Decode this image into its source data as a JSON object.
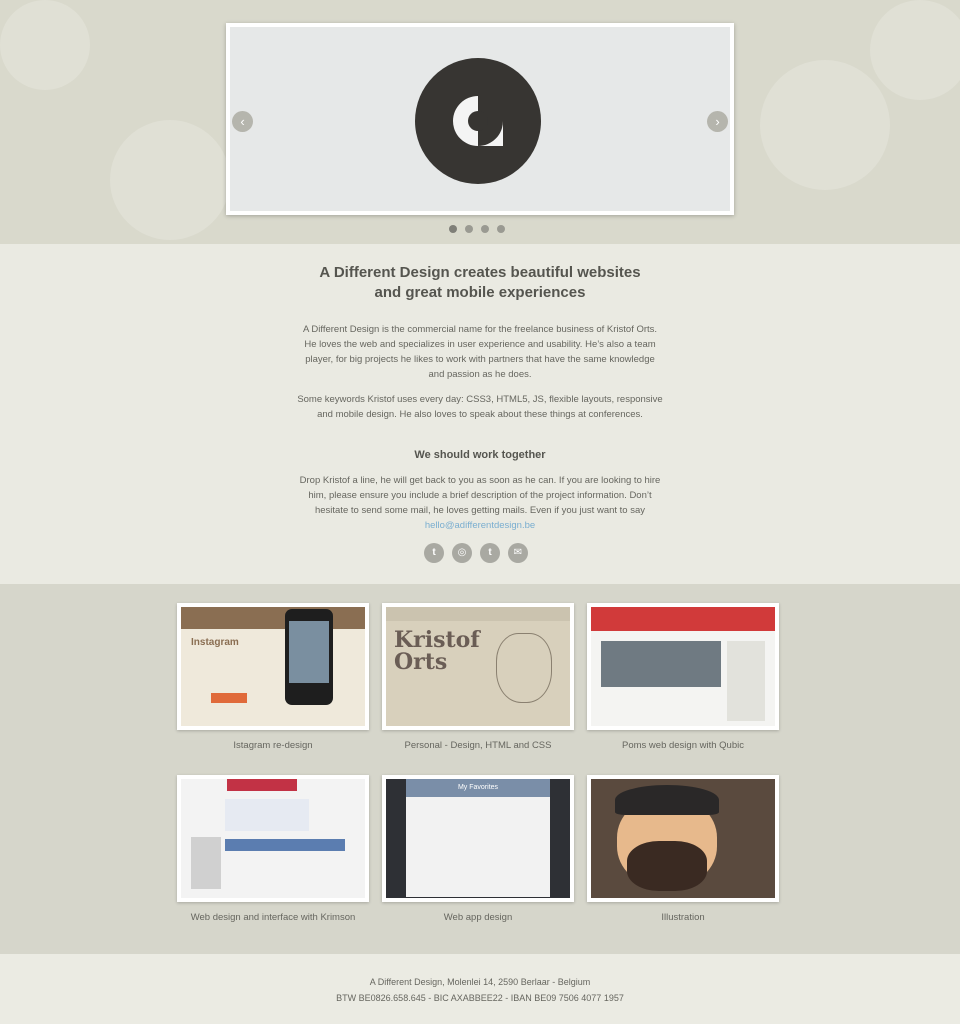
{
  "slider": {
    "prev_icon": "chevron-left-icon",
    "next_icon": "chevron-right-icon",
    "prev_glyph": "‹",
    "next_glyph": "›",
    "logo": "a-different-design-logo",
    "slide_count": 4,
    "active_slide": 1
  },
  "intro": {
    "headline_line1": "A Different Design creates beautiful websites",
    "headline_line2": "and great mobile experiences",
    "paragraph1": "A Different Design is the commercial name for the freelance business of Kristof Orts. He loves the web and specializes in user experience and usability. He’s also a team player, for big projects he likes to work with partners that have the same knowledge and passion as he does.",
    "paragraph2": "Some keywords Kristof uses every day: CSS3, HTML5, JS, flexible layouts, responsive and mobile design. He also loves to speak about these things at conferences."
  },
  "contact": {
    "heading": "We should work together",
    "paragraph": "Drop Kristof a line, he will get back to you as soon as he can. If you are looking to hire him, please ensure you include a brief description of the project information. Don’t hesitate to send some mail, he loves getting mails. Even if you just want to say",
    "email": "hello@adifferentdesign.be",
    "socials": [
      {
        "icon": "twitter-icon",
        "glyph": "t"
      },
      {
        "icon": "dribbble-icon",
        "glyph": "◎"
      },
      {
        "icon": "tumblr-icon",
        "glyph": "t"
      },
      {
        "icon": "mail-icon",
        "glyph": "✉"
      }
    ]
  },
  "portfolio": {
    "items": [
      {
        "caption": "Istagram re-design"
      },
      {
        "caption": "Personal - Design, HTML and CSS"
      },
      {
        "caption": "Poms web design with Qubic"
      },
      {
        "caption": "Web design and interface with Krimson"
      },
      {
        "caption": "Web app design"
      },
      {
        "caption": "Illustration"
      }
    ],
    "thumb_text": {
      "instagram": "Instagram",
      "kristof": "Kristof Orts",
      "app_title": "My Favorites"
    }
  },
  "footer": {
    "line1": "A Different Design, Molenlei 14, 2590 Berlaar - Belgium",
    "line2": "BTW BE0826.658.645 - BIC AXABBEE22 - IBAN BE09 7506 4077 1957"
  },
  "colors": {
    "background": "#e8e8df",
    "hero": "#d9d9cc",
    "portfolio": "#d6d6cb",
    "logo": "#373532",
    "link": "#7aaed0"
  }
}
